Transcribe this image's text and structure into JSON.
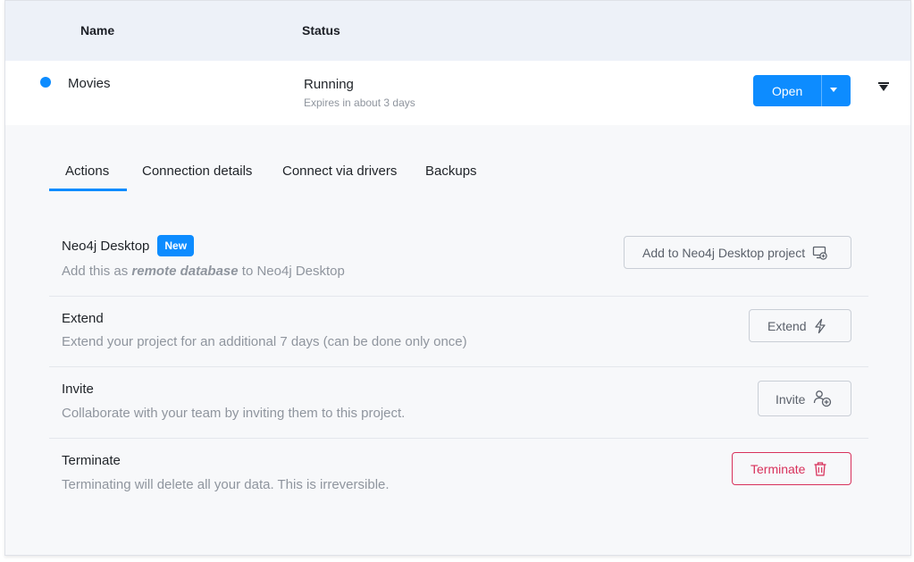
{
  "table": {
    "col_name": "Name",
    "col_status": "Status"
  },
  "project": {
    "name": "Movies",
    "status": "Running",
    "expires": "Expires in about 3 days",
    "status_color": "#0d8cff",
    "open_label": "Open"
  },
  "tabs": [
    {
      "label": "Actions",
      "active": true
    },
    {
      "label": "Connection details",
      "active": false
    },
    {
      "label": "Connect via drivers",
      "active": false
    },
    {
      "label": "Backups",
      "active": false
    }
  ],
  "actions": {
    "desktop": {
      "title": "Neo4j Desktop",
      "badge": "New",
      "desc_prefix": "Add this as ",
      "desc_emphasis": "remote database",
      "desc_suffix": " to Neo4j Desktop",
      "button": "Add to Neo4j Desktop project",
      "icon": "desktop-add-icon"
    },
    "extend": {
      "title": "Extend",
      "desc": "Extend your project for an additional 7 days (can be done only once)",
      "button": "Extend",
      "icon": "lightning-icon"
    },
    "invite": {
      "title": "Invite",
      "desc": "Collaborate with your team by inviting them to this project.",
      "button": "Invite",
      "icon": "user-add-icon"
    },
    "terminate": {
      "title": "Terminate",
      "desc": "Terminating will delete all your data. This is irreversible.",
      "button": "Terminate",
      "icon": "trash-icon"
    }
  },
  "colors": {
    "accent": "#0d8cff",
    "danger": "#d8315b",
    "header_bg": "#edf1f8",
    "panel_bg": "#f7f8fa"
  }
}
